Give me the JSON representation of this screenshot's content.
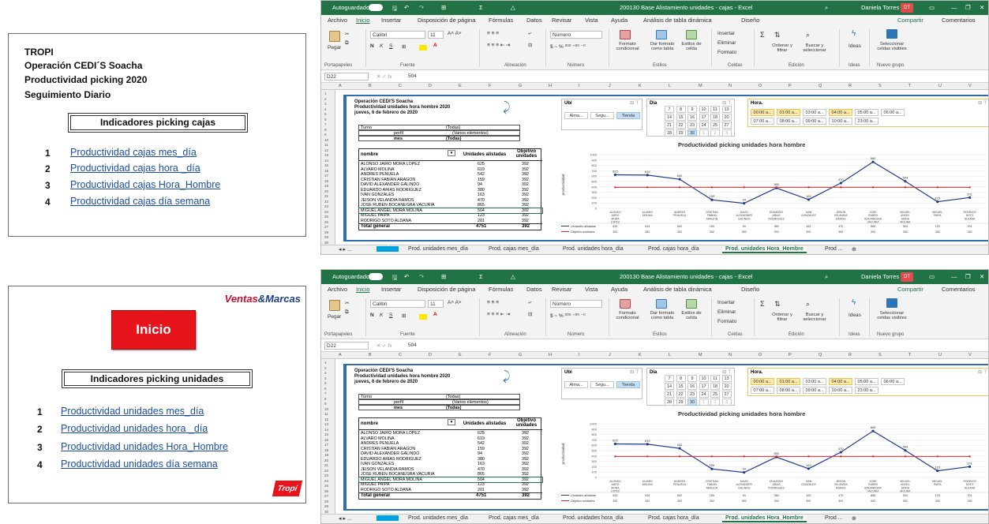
{
  "left_top": {
    "org": "TROPI",
    "operation": "Operación CEDI´S Soacha",
    "productivity": "Productividad picking  2020",
    "tracking": "Seguimiento Diario",
    "box_title": "Indicadores picking cajas",
    "items": [
      {
        "num": "1",
        "label": "Productividad cajas mes_día"
      },
      {
        "num": "2",
        "label": "Productividad cajas hora _día"
      },
      {
        "num": "3",
        "label": "Productividad cajas Hora_Hombre"
      },
      {
        "num": "4",
        "label": "Productividad cajas día semana"
      }
    ]
  },
  "left_bot": {
    "inicio_button": "Inicio",
    "logo_ventas": "Ventas",
    "logo_marcas": "&Marcas",
    "box_title": "Indicadores picking unidades",
    "items": [
      {
        "num": "1",
        "label": "Productividad unidades mes_día"
      },
      {
        "num": "2",
        "label": "Productividad unidades hora _día"
      },
      {
        "num": "3",
        "label": "Productividad unidades Hora_Hombre"
      },
      {
        "num": "4",
        "label": "Productividad unidades día semana"
      }
    ],
    "logo_tropi": "Tropi"
  },
  "excel": {
    "autosave": "Autoguardado",
    "file_title": "200130 Base Alistamiento unidades - cajas  -  Excel",
    "user": "Daniela Torres",
    "user_initials": "DT",
    "menu": [
      "Archivo",
      "Inicio",
      "Insertar",
      "Disposición de página",
      "Fórmulas",
      "Datos",
      "Revisar",
      "Vista",
      "Ayuda",
      "Análisis de tabla dinámica",
      "Diseño"
    ],
    "share": "Compartir",
    "comments": "Comentarios",
    "ribbon": {
      "paste": "Pegar",
      "font_name": "Calibri",
      "font_size": "11",
      "number_format": "Número",
      "cond_format": "Formato condicional",
      "table_format": "Dar formato como tabla",
      "cell_styles": "Estilos de celda",
      "insert": "Insertar",
      "delete": "Eliminar",
      "format": "Formato",
      "sort": "Ordenar y filtrar",
      "find": "Buscar y seleccionar",
      "ideas": "Ideas",
      "select_cells": "Seleccionar celdas visibles",
      "groups": [
        "Portapapeles",
        "Fuente",
        "Alineación",
        "Número",
        "Estilos",
        "Celdas",
        "Edición",
        "Ideas",
        "Nuevo grupo"
      ]
    },
    "name_box": "D22",
    "formula_value": "504",
    "columns": [
      "A",
      "B",
      "C",
      "D",
      "E",
      "F",
      "G",
      "H",
      "I",
      "J",
      "K",
      "L",
      "M",
      "N",
      "O",
      "P",
      "Q",
      "R",
      "S",
      "T",
      "U",
      "V"
    ],
    "tabs": [
      "Inicio",
      "Prod. unidades mes_día",
      "Prod. cajas mes_día",
      "Prod. unidades hora_día",
      "Prod. cajas hora_día",
      "Prod. unidades Hora_Hombre",
      "Prod ..."
    ],
    "report": {
      "line1": "Operación CEDI'S Soacha",
      "line2": "Productividad unidades hora hombre 2020",
      "line3": "jueves, 6 de febrero de 2020",
      "filters": [
        {
          "label": "Turno",
          "value": "(Todas)"
        },
        {
          "label": "perfil",
          "value": "(Varios elementos)"
        },
        {
          "label": "mes",
          "value": "(Todas)"
        }
      ],
      "table_headers": [
        "nombre",
        "Unidades alistadas",
        "Objetivo unidades"
      ],
      "rows": [
        [
          "ALONSO JAIRO MORA LOPEZ",
          "625",
          "392"
        ],
        [
          "ALVARO MOLINA",
          "619",
          "392"
        ],
        [
          "ANDRES PENUELA",
          "542",
          "392"
        ],
        [
          "CRISTIAN FABIAN ARAGON",
          "159",
          "392"
        ],
        [
          "DAVID ALEXANDER GALINDO",
          "94",
          "392"
        ],
        [
          "EDUARDO ARIAS RODRIGUEZ",
          "380",
          "392"
        ],
        [
          "IVAN GONZALES",
          "163",
          "392"
        ],
        [
          "JEISON VELANDIA RAMOS",
          "470",
          "392"
        ],
        [
          "JOSE RUBEN BOCANEGRA VACURIA",
          "865",
          "392"
        ],
        [
          "MIGUEL ANGEL MORA MOLINA",
          "504",
          "392"
        ],
        [
          "MIGUEL PAIPA",
          "123",
          "392"
        ],
        [
          "RODRIGO SOTO ALDANA",
          "201",
          "392"
        ]
      ],
      "total_label": "Total general",
      "total_value": "4751",
      "total_obj": "392"
    },
    "slicers": {
      "ubi_title": "Ubi",
      "ubi_items": [
        "Alma...",
        "Segu...",
        "Tienda"
      ],
      "dia_title": "Dia",
      "dia_items": [
        "7",
        "8",
        "9",
        "10",
        "11",
        "13",
        "14",
        "15",
        "16",
        "17",
        "18",
        "20",
        "21",
        "22",
        "23",
        "24",
        "25",
        "27",
        "28",
        "29",
        "30",
        "1",
        "2",
        "3"
      ],
      "hora_title": "Hora.",
      "hora_items": [
        "00:00 a...",
        "01:00 a...",
        "03:00 a...",
        "04:00 a...",
        "05:00 a...",
        "06:00 a...",
        "07:00 a...",
        "08:00 a...",
        "09:00 a...",
        "10:00 a...",
        "23:00 a..."
      ]
    }
  },
  "chart_data": {
    "type": "line",
    "title": "Productividad picking unidades hora hombre",
    "ylabel": "productividad",
    "ylim": [
      0,
      1000
    ],
    "yticks": [
      "0",
      "100",
      "200",
      "300",
      "400",
      "500",
      "600",
      "700",
      "800",
      "900",
      "1000"
    ],
    "categories": [
      "ALONSO JAIRO MORA LOPEZ",
      "ALVARO MOLINA",
      "ANDRES PENUELA",
      "CRISTIAN FABIAN ARAGON",
      "DAVID ALEXANDER GALINDO",
      "EDUARDO ARIAS RODRIGUEZ",
      "IVAN GONZALES",
      "JEISON VELANDIA RAMOS",
      "JOSE RUBEN BOCANEGRA VACURIA",
      "MIGUEL ANGEL MORA MOLINA",
      "MIGUEL PAIPA",
      "RODRIGO SOTO ALDANA"
    ],
    "series": [
      {
        "name": "Unidades alistadas",
        "values": [
          625,
          619,
          542,
          159,
          94,
          380,
          163,
          470,
          865,
          504,
          123,
          201
        ],
        "color": "#1f3a8a"
      },
      {
        "name": "Objetivo unidades",
        "values": [
          392,
          392,
          392,
          392,
          392,
          392,
          392,
          392,
          392,
          392,
          392,
          392
        ],
        "color": "#e0262b"
      }
    ]
  }
}
